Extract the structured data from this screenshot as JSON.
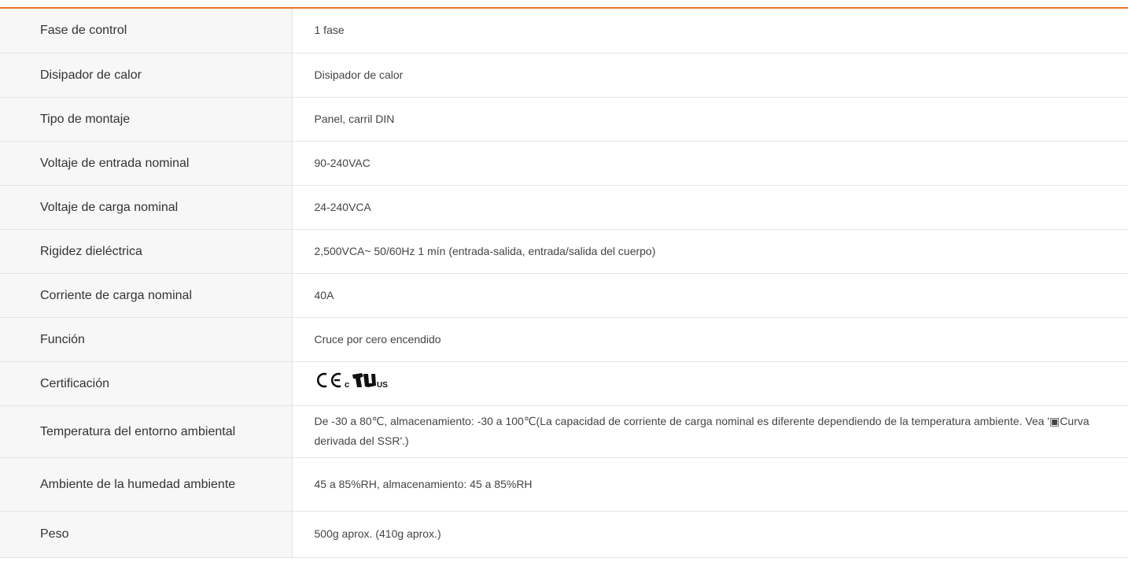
{
  "colors": {
    "accent": "#e8722a",
    "label_bg": "#f7f7f7",
    "border": "#e4e4e4"
  },
  "rows": [
    {
      "label": "Fase de control",
      "value": "1 fase"
    },
    {
      "label": "Disipador de calor",
      "value": "Disipador de calor"
    },
    {
      "label": "Tipo de montaje",
      "value": "Panel, carril DIN"
    },
    {
      "label": "Voltaje de entrada nominal",
      "value": "90-240VAC"
    },
    {
      "label": "Voltaje de carga nominal",
      "value": "24-240VCA"
    },
    {
      "label": "Rigidez dieléctrica",
      "value": "2,500VCA~ 50/60Hz 1 mín (entrada-salida, entrada/salida del cuerpo)"
    },
    {
      "label": "Corriente de carga nominal",
      "value": "40A"
    },
    {
      "label": "Función",
      "value": "Cruce por cero encendido"
    },
    {
      "label": "Certificación",
      "value_icons": [
        "ce-mark-icon",
        "cul-us-mark-icon"
      ],
      "cert_text": {
        "c": "c",
        "us": "US"
      }
    },
    {
      "label": "Temperatura del entorno ambiental",
      "value": "De -30 a 80℃, almacenamiento: -30 a 100℃(La capacidad de corriente de carga nominal es diferente dependiendo de la temperatura ambiente. Vea '▣Curva derivada del SSR'.)"
    },
    {
      "label": "Ambiente de la humedad ambiente",
      "value": "45 a 85%RH, almacenamiento: 45 a 85%RH"
    },
    {
      "label": "Peso",
      "value": "500g aprox. (410g aprox.)"
    }
  ]
}
